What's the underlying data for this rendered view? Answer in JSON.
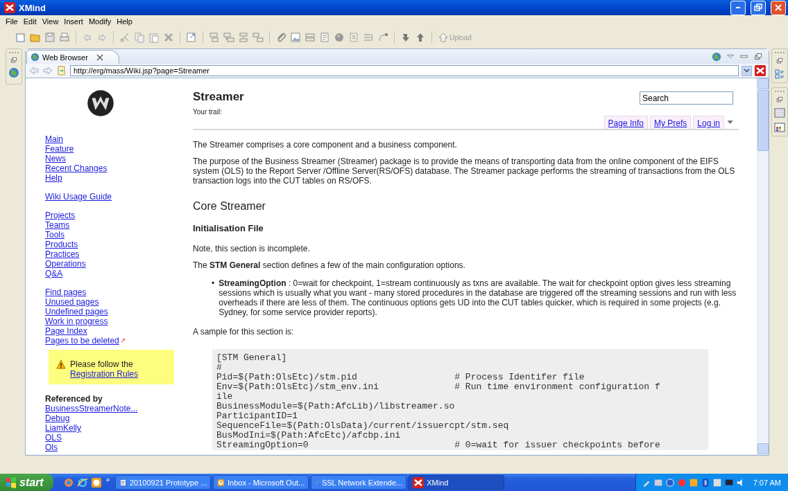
{
  "window": {
    "title": "XMind"
  },
  "menu": [
    "File",
    "Edit",
    "View",
    "Insert",
    "Modify",
    "Help"
  ],
  "toolbar": {
    "upload": {
      "label": "Upload",
      "disabled": true
    }
  },
  "editor_tab": {
    "label": "Web Browser",
    "selected": true
  },
  "address": {
    "value": "http://erg/mass/Wiki.jsp?page=Streamer"
  },
  "sidebar": {
    "groups": [
      [
        "Main",
        "Feature",
        "News",
        "Recent Changes",
        "Help"
      ],
      [
        "Wiki Usage Guide"
      ],
      [
        "Projects",
        "Teams",
        "Tools",
        "Products",
        "Practices",
        "Operations",
        "Q&A"
      ],
      [
        "Find pages",
        "Unused pages",
        "Undefined pages",
        "Work in progress",
        "Page Index",
        "Pages to be deleted"
      ]
    ],
    "notice": {
      "text": "Please follow the",
      "link": "Registration Rules"
    },
    "referenced_by": {
      "title": "Referenced by",
      "links": [
        "BusinessStreamerNote...",
        "Debug",
        "LiamKelly",
        "OLS",
        "Ols"
      ]
    }
  },
  "page": {
    "title": "Streamer",
    "trail": "Your trail:",
    "search": {
      "placeholder": "Search"
    },
    "tabs": [
      "Page Info",
      "My Prefs",
      "Log in"
    ],
    "blocks": [
      {
        "kind": "p",
        "text": "The Streamer comprises a core component and a business component."
      },
      {
        "kind": "p",
        "text": "The purpose of the Business Streamer (Streamer) package is to provide the means of transporting data from the online component of the EIFS system (OLS) to the Report Server /Offline Server(RS/OFS) database. The Streamer package performs the streaming of transactions from the OLS transaction logs into the CUT tables on RS/OFS."
      },
      {
        "kind": "h2",
        "text": "Core Streamer"
      },
      {
        "kind": "h3",
        "text": "Initialisation File"
      },
      {
        "kind": "p",
        "text": "Note, this section is incomplete."
      },
      {
        "kind": "p",
        "text": "The **STM General** section defines a few of the main configuration options."
      },
      {
        "kind": "bullet",
        "marker": "•",
        "text": "**StreamingOption** : 0=wait for checkpoint, 1=stream continuously as txns are available. The wait for checkpoint option gives less streaming sessions which is usually what you want - many stored procedures in the database are triggered off the streaming sessions and run with less overheads if there are less of them. The continuous options gets UD into the CUT tables quicker, which is required in some projects (e.g. Sydney, for some service provider reports)."
      },
      {
        "kind": "p",
        "text": "A sample for this section is:"
      },
      {
        "kind": "code",
        "lines": [
          "[STM General]",
          "#",
          "Pid=$(Path:OlsEtc)/stm.pid                  # Process Identifer file",
          "Env=$(Path:OlsEtc)/stm_env.ini              # Run time environment configuration f",
          "ile",
          "BusinessModule=$(Path:AfcLib)/libstreamer.so",
          "ParticipantID=1",
          "SequenceFile=$(Path:OlsData)/current/issuercpt/stm.seq",
          "BusModIni=$(Path:AfcEtc)/afcbp.ini",
          "StreamingOption=0                           # 0=wait for issuer checkpoints before"
        ]
      }
    ]
  },
  "taskbar": {
    "start": "start",
    "more": "»",
    "tasks": [
      {
        "label": "20100921 Prototype ...",
        "kind": "word",
        "selected": false
      },
      {
        "label": "Inbox - Microsoft Out...",
        "kind": "outlook",
        "selected": false
      },
      {
        "label": "SSL Network Extende...",
        "kind": "browser",
        "selected": false
      },
      {
        "label": "XMind",
        "kind": "xmind",
        "selected": true
      }
    ],
    "clock": "7:07 AM"
  }
}
